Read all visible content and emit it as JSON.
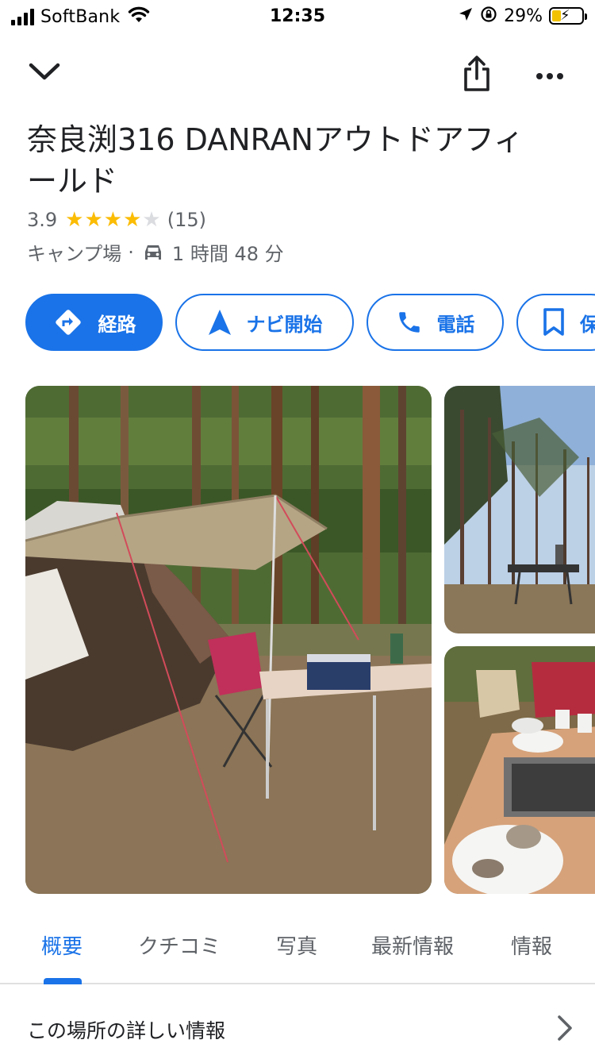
{
  "status_bar": {
    "carrier": "SoftBank",
    "time": "12:35",
    "battery_percent": "29%"
  },
  "place": {
    "title": "奈良渕316 DANRANアウトドアフィールド",
    "rating": "3.9",
    "rating_stars": 4,
    "review_count": "(15)",
    "category": "キャンプ場",
    "separator": "·",
    "drive_time": "1 時間 48 分"
  },
  "actions": {
    "directions": "経路",
    "navigate": "ナビ開始",
    "call": "電話",
    "save": "保"
  },
  "tabs": [
    "概要",
    "クチコミ",
    "写真",
    "最新情報",
    "情報"
  ],
  "active_tab": "概要",
  "details": {
    "label": "この場所の詳しい情報"
  },
  "icons": {
    "collapse": "chevron-down-icon",
    "share": "share-icon",
    "more": "more-vert-icon",
    "car": "car-icon",
    "directions": "directions-icon",
    "navigate": "navigation-arrow-icon",
    "call": "phone-icon",
    "save": "bookmark-icon",
    "detail_chevron": "chevron-right-icon"
  },
  "colors": {
    "accent": "#1a73e8",
    "star": "#fbbc04",
    "star_empty": "#dadce0",
    "secondary_text": "#5f6368"
  }
}
